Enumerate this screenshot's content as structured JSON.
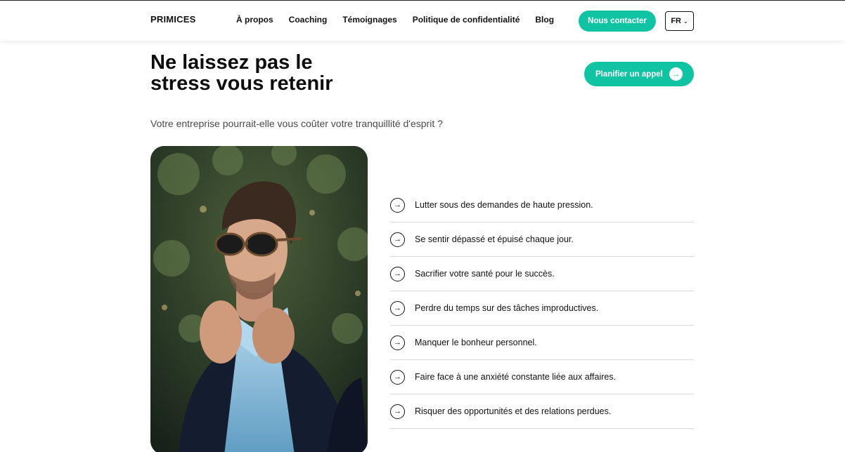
{
  "header": {
    "logo": "PRIMICES",
    "nav": [
      "À propos",
      "Coaching",
      "Témoignages",
      "Politique de confidentialité",
      "Blog"
    ],
    "contact_label": "Nous contacter",
    "lang_label": "FR"
  },
  "hero": {
    "headline_line1": "Ne laissez pas le",
    "headline_line2": "stress vous retenir",
    "call_label": "Planifier un appel",
    "subtitle": "Votre entreprise pourrait-elle vous coûter votre tranquillité d'esprit ?"
  },
  "pain_points": [
    "Lutter sous des demandes de haute pression.",
    "Se sentir dépassé et épuisé chaque jour.",
    "Sacrifier votre santé pour le succès.",
    "Perdre du temps sur des tâches improductives.",
    "Manquer le bonheur personnel.",
    "Faire face à une anxiété constante liée aux affaires.",
    "Risquer des opportunités et des relations perdues."
  ],
  "colors": {
    "accent": "#10c3a3",
    "text": "#111111"
  },
  "icons": {
    "list_marker": "arrow-right-circle-icon",
    "lang_dropdown": "chevron-down-icon"
  }
}
